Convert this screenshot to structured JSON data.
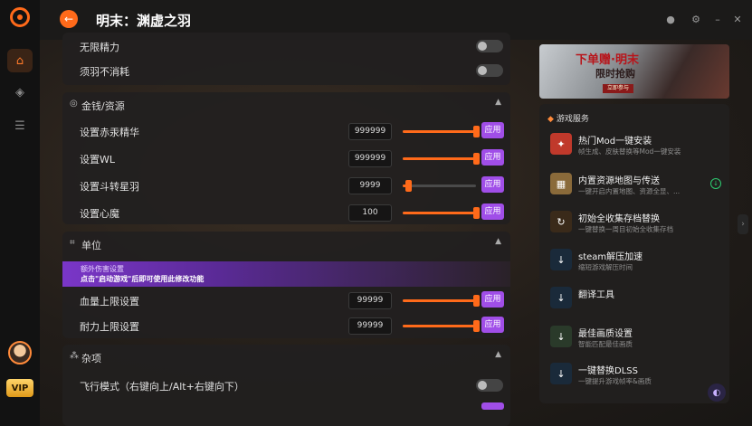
{
  "app": {
    "title": "明末：渊虚之羽"
  },
  "colors": {
    "accent": "#ff6a1a",
    "purple": "#a04ee8",
    "background": "#161514"
  },
  "sidebar": {
    "vip_label": "VIP",
    "icons": [
      "home-icon",
      "gamepad-icon",
      "database-icon"
    ]
  },
  "top_rows": [
    {
      "label": "无限精力",
      "on": false
    },
    {
      "label": "须羽不消耗",
      "on": false
    }
  ],
  "money_section": {
    "title": "金钱/资源",
    "rows": [
      {
        "label": "设置赤汞精华",
        "value": "999999",
        "level": 1.0,
        "apply": "应用"
      },
      {
        "label": "设置WL",
        "value": "999999",
        "level": 1.0,
        "apply": "应用"
      },
      {
        "label": "设置斗转星羽",
        "value": "9999",
        "level": 0.08,
        "apply": "应用"
      },
      {
        "label": "设置心魔",
        "value": "100",
        "level": 1.0,
        "apply": "应用"
      }
    ]
  },
  "unit_section": {
    "title": "单位",
    "damage_banner": {
      "title": "额外伤害设置",
      "hint": "点击\"启动游戏\"后即可使用此修改功能"
    },
    "rows": [
      {
        "label": "血量上限设置",
        "value": "99999",
        "level": 1.0,
        "apply": "应用"
      },
      {
        "label": "耐力上限设置",
        "value": "99999",
        "level": 1.0,
        "apply": "应用"
      }
    ]
  },
  "misc_section": {
    "title": "杂项",
    "rows": [
      {
        "label": "飞行模式（右键向上/Alt+右键向下）",
        "on": false
      }
    ]
  },
  "promo": {
    "line1": "下单赠·明末",
    "line2": "限时抢购",
    "button": "立即参与"
  },
  "services": {
    "title": "游戏服务",
    "items": [
      {
        "name": "热门Mod一键安装",
        "desc": "帧生成、皮肤替换等Mod一键安装",
        "icon": "mod-icon",
        "color": "#c0392b"
      },
      {
        "name": "内置资源地图与传送",
        "desc": "一键开启内置地图、资源全显、...",
        "icon": "map-icon",
        "color": "#8a6a3a",
        "download": true
      },
      {
        "name": "初始全收集存档替换",
        "desc": "一键替换一周目初始全收集存档",
        "icon": "save-icon",
        "color": "#3a2a1a"
      },
      {
        "name": "steam解压加速",
        "desc": "缩短游戏解压时间",
        "icon": "steam-icon",
        "color": "#1a2a3a"
      },
      {
        "name": "翻译工具",
        "desc": "",
        "icon": "translate-icon",
        "color": "#1a2a3a"
      },
      {
        "name": "最佳画质设置",
        "desc": "智能匹配最佳画质",
        "icon": "quality-icon",
        "color": "#2a3a2a"
      },
      {
        "name": "一键替换DLSS",
        "desc": "一键提升游戏帧率&画质",
        "icon": "dlss-icon",
        "color": "#1a2a3a"
      }
    ]
  }
}
